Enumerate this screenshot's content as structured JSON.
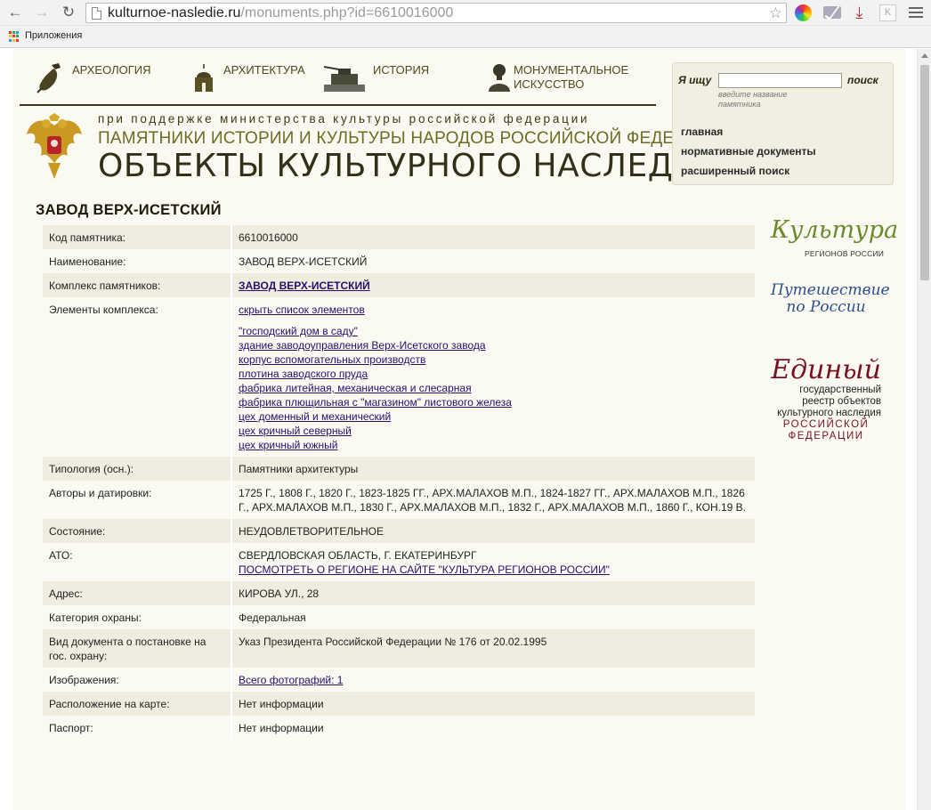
{
  "browser": {
    "url_host": "kulturnoe-nasledie.ru",
    "url_path": "/monuments.php?id=6610016000",
    "bookmarks_apps_label": "Приложения"
  },
  "nav": {
    "archaeology": "АРХЕОЛОГИЯ",
    "architecture": "АРХИТЕКТУРА",
    "history": "ИСТОРИЯ",
    "monumental_line1": "МОНУМЕНТАЛЬНОЕ",
    "monumental_line2": "ИСКУССТВО"
  },
  "header": {
    "support": "при поддержке министерства культуры российской федерации",
    "title1": "ПАМЯТНИКИ ИСТОРИИ И КУЛЬТУРЫ НАРОДОВ РОССИЙСКОЙ ФЕДЕРАЦИИ",
    "title2": "ОБЪЕКТЫ КУЛЬТУРНОГО НАСЛЕДИЯ"
  },
  "search": {
    "label": "Я ищу",
    "value": "",
    "button": "поиск",
    "hint": "введите название памятника"
  },
  "side_links": [
    "главная",
    "нормативные документы",
    "расширенный поиск"
  ],
  "page_title": "ЗАВОД ВЕРХ-ИСЕТСКИЙ",
  "rows": {
    "code_label": "Код памятника:",
    "code_value": "6610016000",
    "name_label": "Наименование:",
    "name_value": "ЗАВОД ВЕРХ-ИСЕТСКИЙ",
    "complex_label": "Комплекс памятников:",
    "complex_link": "ЗАВОД ВЕРХ-ИСЕТСКИЙ",
    "elements_label": "Элементы комплекса:",
    "elements_toggle": "скрыть список элементов",
    "elements": [
      "\"господский дом в саду\"",
      "здание заводоуправления Верх-Исетского завода",
      "корпус вспомогательных производств",
      "плотина заводского пруда",
      "фабрика литейная, механическая и слесарная",
      "фабрика плющильная с \"магазином\" листового железа",
      "цех доменный и механический",
      "цех кричный северный",
      "цех кричный южный"
    ],
    "typology_label": "Типология (осн.):",
    "typology_value": "Памятники архитектуры",
    "authors_label": "Авторы и датировки:",
    "authors_value": "1725 Г., 1808 Г., 1820 Г., 1823-1825 ГГ., АРХ.МАЛАХОВ М.П., 1824-1827 ГГ., АРХ.МАЛАХОВ М.П., 1826 Г., АРХ.МАЛАХОВ М.П., 1830 Г., АРХ.МАЛАХОВ М.П., 1832 Г., АРХ.МАЛАХОВ М.П., 1860 Г., КОН.19 В.",
    "state_label": "Состояние:",
    "state_value": "НЕУДОВЛЕТВОРИТЕЛЬНОЕ",
    "ato_label": "АТО:",
    "ato_value": "СВЕРДЛОВСКАЯ ОБЛАСТЬ, Г. ЕКАТЕРИНБУРГ",
    "ato_link": "ПОСМОТРЕТЬ О РЕГИОНЕ НА САЙТЕ \"КУЛЬТУРА РЕГИОНОВ РОССИИ\"",
    "address_label": "Адрес:",
    "address_value": "КИРОВА УЛ., 28",
    "category_label": "Категория охраны:",
    "category_value": "Федеральная",
    "doc_label": "Вид документа о постановке на гос. охрану:",
    "doc_value": "Указ Президента Российской Федерации № 176 от 20.02.1995",
    "images_label": "Изображения:",
    "images_link": "Всего фотографий: 1",
    "map_label": "Расположение на карте:",
    "map_value": "Нет информации",
    "passport_label": "Паспорт:",
    "passport_value": "Нет информации"
  },
  "banners": {
    "kultura_big": "Культура",
    "kultura_small": "РЕГИОНОВ РОССИИ",
    "travel_line1": "Путешествие",
    "travel_line2": "по России",
    "registry_big": "Единый",
    "registry_line1": "государственный",
    "registry_line2": "реестр объектов",
    "registry_line3": "культурного наследия",
    "registry_line4": "РОССИЙСКОЙ",
    "registry_line5": "ФЕДЕРАЦИИ"
  },
  "colors": {
    "page_background": "#fafaf2",
    "row_shade": "#eeeddf",
    "link": "#2a0e6e",
    "header_dark": "#33301a",
    "header_olive": "#6f6b24"
  }
}
